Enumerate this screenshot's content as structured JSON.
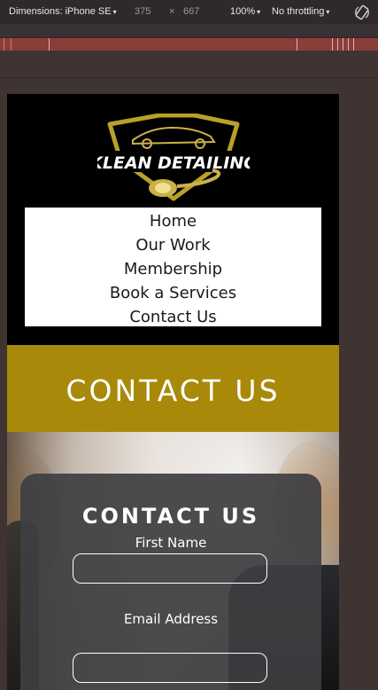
{
  "devtools": {
    "dimensions_label": "Dimensions: iPhone SE",
    "width": "375",
    "times": "×",
    "height": "667",
    "zoom": "100%",
    "throttling": "No throttling",
    "caret": "▾",
    "rotate_icon": "rotate-icon"
  },
  "site": {
    "logo_text": "KLEAN DETAILING",
    "nav": [
      "Home",
      "Our Work",
      "Membership",
      "Book a Services",
      "Contact Us"
    ],
    "hero_title": "CONTACT US",
    "form": {
      "title": "CONTACT US",
      "first_name_label": "First Name",
      "email_label": "Email Address",
      "first_name_value": "",
      "email_value": ""
    }
  },
  "colors": {
    "hero_gold": "#a8890a",
    "logo_gold": "#b8a12a",
    "panel": "#3e3e42"
  }
}
